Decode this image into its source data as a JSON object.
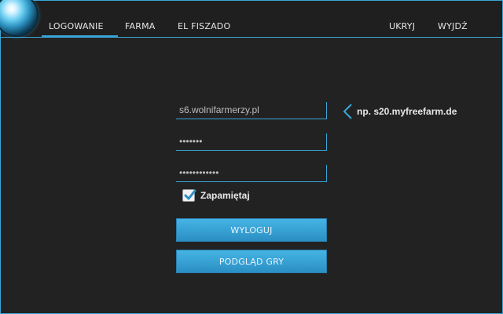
{
  "nav": {
    "left": [
      "LOGOWANIE",
      "FARMA",
      "EL FISZADO"
    ],
    "right": [
      "UKRYJ",
      "WYJDŹ"
    ],
    "active": "LOGOWANIE"
  },
  "form": {
    "server_value": "s6.wolnifarmerzy.pl",
    "username_value": "•••••••",
    "password_value": "••••••••••••",
    "hint": "np. s20.myfreefarm.de",
    "remember_label": "Zapamiętaj",
    "remember_checked": true,
    "logout_button": "WYLOGUJ",
    "preview_button": "PODGLĄD GRY"
  },
  "colors": {
    "accent": "#3aa6d8",
    "background": "#222222",
    "button": "#3aa6d8"
  },
  "icons": {
    "logo": "orb-logo-icon",
    "hint": "chevron-left-icon",
    "check": "checkmark-icon"
  }
}
